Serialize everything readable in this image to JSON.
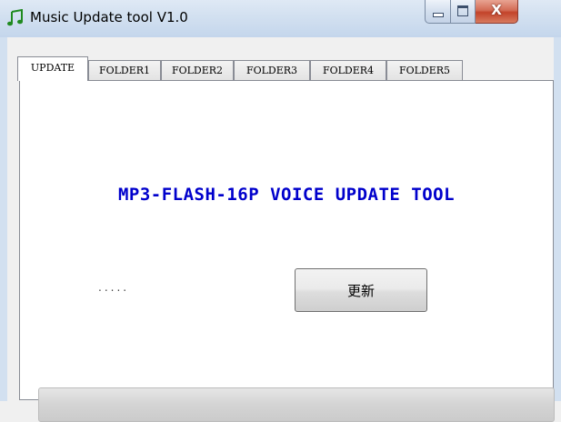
{
  "window": {
    "title": "Music Update tool V1.0",
    "app_icon": "music-note-icon",
    "controls": {
      "minimize": "minimize-icon",
      "maximize": "maximize-icon",
      "close": "close-icon",
      "close_glyph": "X"
    }
  },
  "tabs": [
    {
      "label": "UPDATE",
      "active": true
    },
    {
      "label": "FOLDER1",
      "active": false
    },
    {
      "label": "FOLDER2",
      "active": false
    },
    {
      "label": "FOLDER3",
      "active": false
    },
    {
      "label": "FOLDER4",
      "active": false
    },
    {
      "label": "FOLDER5",
      "active": false
    }
  ],
  "update_panel": {
    "heading": "MP3-FLASH-16P VOICE UPDATE TOOL",
    "status_text": ".....",
    "update_button": "更新",
    "progress_percent": 0
  },
  "colors": {
    "heading": "#0000cc",
    "app_icon": "#1f8a1f",
    "progress_fill": "#06b025"
  }
}
